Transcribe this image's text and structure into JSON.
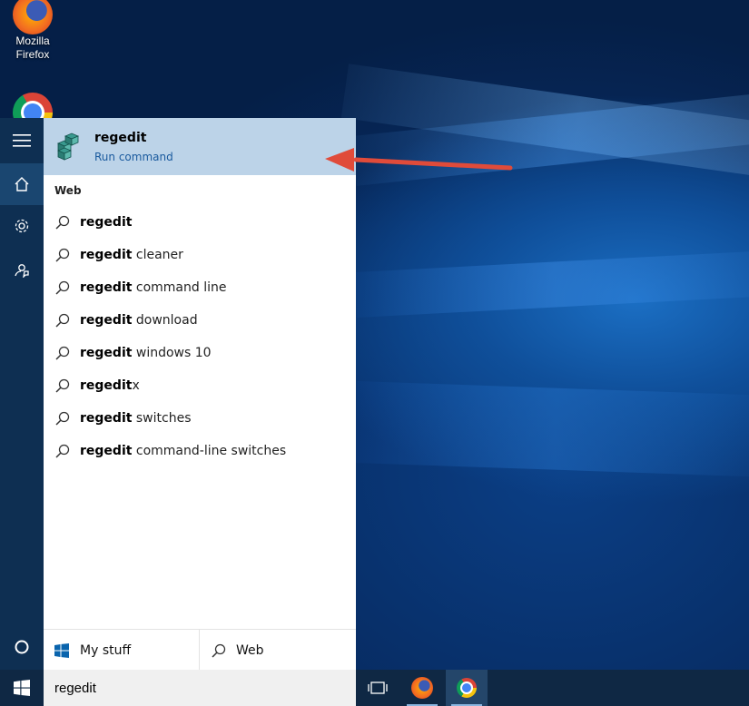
{
  "desktop": {
    "icons": [
      {
        "label_line1": "Mozilla",
        "label_line2": "Firefox",
        "icon": "firefox-icon"
      },
      {
        "icon": "chrome-icon"
      }
    ]
  },
  "start_rail": {
    "buttons": [
      {
        "icon": "hamburger-menu-icon"
      },
      {
        "icon": "home-icon",
        "active": true
      },
      {
        "icon": "gear-icon"
      },
      {
        "icon": "feedback-icon"
      },
      {
        "icon": "cortana-circle-icon"
      }
    ]
  },
  "best_match": {
    "title": "regedit",
    "subtitle": "Run command",
    "icon": "regedit-icon"
  },
  "web_section": {
    "heading": "Web",
    "results": [
      {
        "bold": "regedit",
        "rest": ""
      },
      {
        "bold": "regedit",
        "rest": " cleaner"
      },
      {
        "bold": "regedit",
        "rest": " command line"
      },
      {
        "bold": "regedit",
        "rest": " download"
      },
      {
        "bold": "regedit",
        "rest": " windows 10"
      },
      {
        "bold": "regedit",
        "rest": "x"
      },
      {
        "bold": "regedit",
        "rest": " switches"
      },
      {
        "bold": "regedit",
        "rest": " command-line switches"
      }
    ]
  },
  "filters": {
    "my_stuff": "My stuff",
    "web": "Web"
  },
  "taskbar": {
    "search_value": "regedit",
    "items": [
      "task-view-icon",
      "firefox-icon",
      "chrome-icon"
    ]
  },
  "colors": {
    "highlight": "#bcd3e8",
    "rail": "#0e2f52",
    "arrow": "#e04b3a",
    "link": "#1a5a9e"
  }
}
